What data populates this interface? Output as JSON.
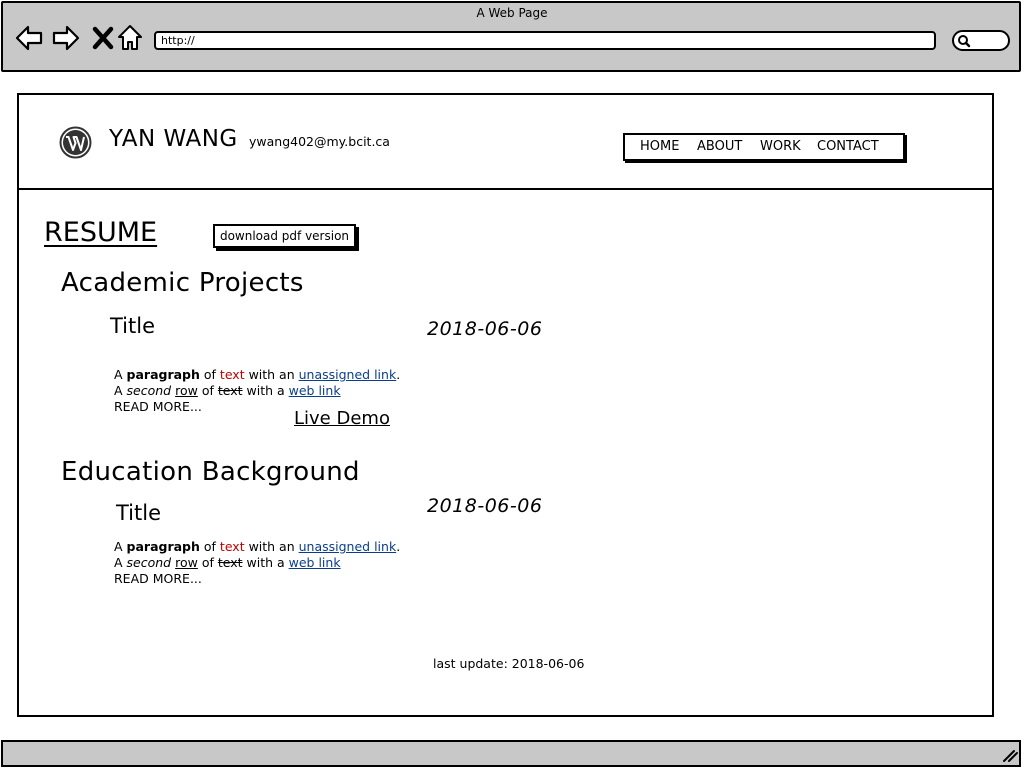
{
  "browser": {
    "window_title": "A Web Page",
    "url": "http://"
  },
  "site": {
    "name": "YAN WANG",
    "email": "ywang402@my.bcit.ca",
    "nav": [
      "HOME",
      "ABOUT",
      "WORK",
      "CONTACT"
    ]
  },
  "resume": {
    "heading": "RESUME",
    "download_label": "download pdf version",
    "sections": [
      {
        "title": "Academic Projects",
        "entry": {
          "title": "Title",
          "date": "2018-06-06",
          "line1": {
            "a": "A ",
            "bold": "paragraph",
            "of": " of ",
            "red": "text",
            "mid": " with an ",
            "link": "unassigned link",
            "end": "."
          },
          "line2": {
            "a": "A ",
            "italic": "second",
            "sp": " ",
            "under": "row",
            "of": " of ",
            "strike": "text",
            "mid": " with a ",
            "link": "web link"
          },
          "read_more": "READ MORE...",
          "demo": "Live Demo"
        }
      },
      {
        "title": "Education Background",
        "entry": {
          "title": "Title",
          "date": "2018-06-06",
          "line1": {
            "a": "A ",
            "bold": "paragraph",
            "of": " of ",
            "red": "text",
            "mid": " with an ",
            "link": "unassigned link",
            "end": "."
          },
          "line2": {
            "a": "A ",
            "italic": "second",
            "sp": " ",
            "under": "row",
            "of": " of ",
            "strike": "text",
            "mid": " with a ",
            "link": "web link"
          },
          "read_more": "READ MORE..."
        }
      }
    ],
    "footer": "last update: 2018-06-06"
  },
  "colors": {
    "chrome_gray": "#c8c8c8",
    "red_text": "#c00000",
    "link_blue": "#0a3e8c"
  },
  "icons": [
    "back-icon",
    "forward-icon",
    "close-icon",
    "home-icon",
    "search-icon",
    "wordpress-logo-icon",
    "resize-grip-icon"
  ]
}
